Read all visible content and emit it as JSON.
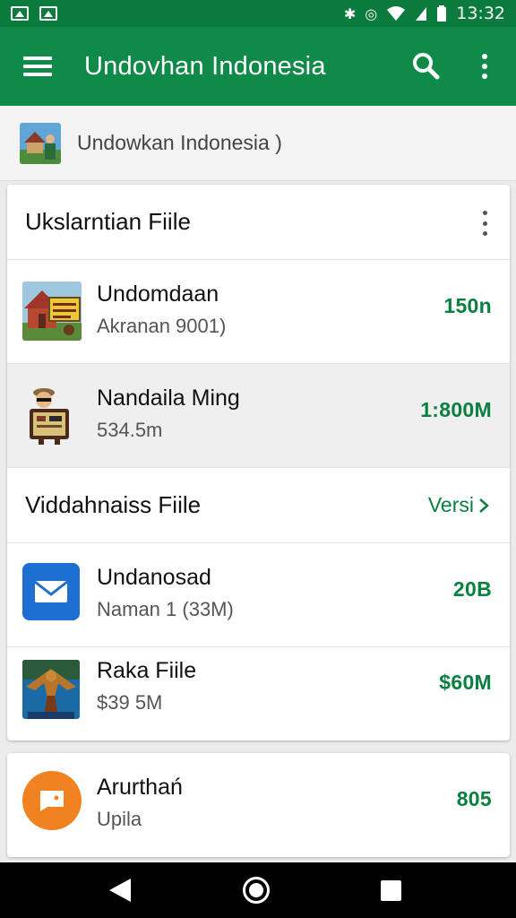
{
  "status_bar": {
    "time": "13:32"
  },
  "app_bar": {
    "title": "Undovhan Indonesia"
  },
  "breadcrumb": {
    "text": "Undowkan Indonesia )"
  },
  "sections": [
    {
      "title": "Ukslarntian Fiile",
      "items": [
        {
          "name": "Undomdaan",
          "sub": "Akranan 9001)",
          "value": "150n",
          "icon": "house-thumbnail",
          "selected": false
        },
        {
          "name": "Nandaila Ming",
          "sub": "534.5m",
          "value": "1:800M",
          "icon": "character-thumbnail",
          "selected": true
        }
      ]
    },
    {
      "title": "Viddahnaiss Fiile",
      "link": "Versi",
      "items": [
        {
          "name": "Undanosad",
          "sub": "Naman 1 (33M)",
          "value": "20B",
          "icon": "mail-icon",
          "selected": false
        },
        {
          "name": "Raka Fiile",
          "sub": "$39 5M",
          "value": "$60M",
          "icon": "eagle-thumbnail",
          "selected": false
        }
      ]
    }
  ],
  "extra_item": {
    "name": "Arurthań",
    "sub": "Upila",
    "value": "805",
    "icon": "chat-icon"
  },
  "colors": {
    "primary": "#108a48",
    "status": "#0b7a3d",
    "accent": "#0a8040"
  }
}
